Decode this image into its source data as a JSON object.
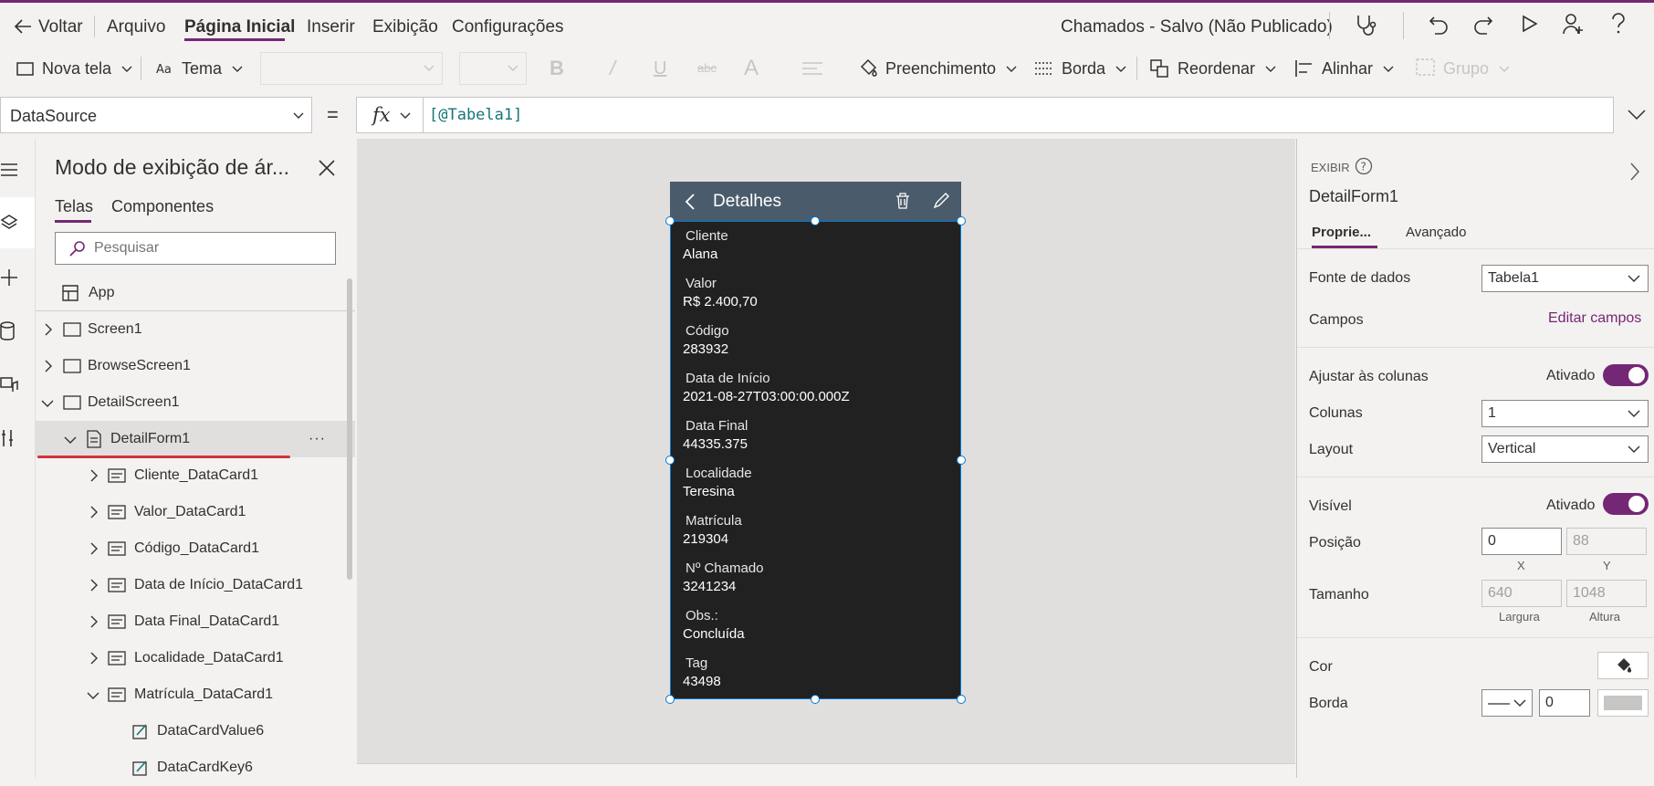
{
  "menubar": {
    "back": "Voltar",
    "items": [
      "Arquivo",
      "Página Inicial",
      "Inserir",
      "Exibição",
      "Configurações"
    ],
    "doc_title": "Chamados - Salvo (Não Publicado)"
  },
  "toolbar": {
    "new_screen": "Nova tela",
    "theme": "Tema",
    "fill": "Preenchimento",
    "border": "Borda",
    "reorder": "Reordenar",
    "align": "Alinhar",
    "group": "Grupo"
  },
  "formula": {
    "property": "DataSource",
    "equals": "=",
    "fx": "fx",
    "expression": "[@Tabela1]"
  },
  "tree": {
    "title": "Modo de exibição de ár...",
    "tabs": [
      "Telas",
      "Componentes"
    ],
    "search_placeholder": "Pesquisar",
    "items": [
      "App",
      "Screen1",
      "BrowseScreen1",
      "DetailScreen1",
      "DetailForm1",
      "Cliente_DataCard1",
      "Valor_DataCard1",
      "Código_DataCard1",
      "Data de Início_DataCard1",
      "Data Final_DataCard1",
      "Localidade_DataCard1",
      "Matrícula_DataCard1",
      "DataCardValue6",
      "DataCardKey6"
    ],
    "more": "···"
  },
  "screen": {
    "header_title": "Detalhes",
    "fields": [
      {
        "key": "Cliente",
        "value": "Alana"
      },
      {
        "key": "Valor",
        "value": "R$ 2.400,70"
      },
      {
        "key": "Código",
        "value": "283932"
      },
      {
        "key": "Data de Início",
        "value": "2021-08-27T03:00:00.000Z"
      },
      {
        "key": "Data Final",
        "value": "44335.375"
      },
      {
        "key": "Localidade",
        "value": "Teresina"
      },
      {
        "key": "Matrícula",
        "value": "219304"
      },
      {
        "key": "Nº Chamado",
        "value": "3241234"
      },
      {
        "key": "Obs.:",
        "value": "Concluída"
      },
      {
        "key": "Tag",
        "value": "43498"
      }
    ]
  },
  "properties": {
    "section": "EXIBIR",
    "control_name": "DetailForm1",
    "tabs": [
      "Proprie...",
      "Avançado"
    ],
    "datasource_label": "Fonte de dados",
    "datasource_value": "Tabela1",
    "fields_label": "Campos",
    "edit_fields": "Editar campos",
    "snap_label": "Ajustar às colunas",
    "snap_state": "Ativado",
    "columns_label": "Colunas",
    "columns_value": "1",
    "layout_label": "Layout",
    "layout_value": "Vertical",
    "visible_label": "Visível",
    "visible_state": "Ativado",
    "position_label": "Posição",
    "pos_x": "0",
    "pos_y": "88",
    "x_caption": "X",
    "y_caption": "Y",
    "size_label": "Tamanho",
    "width": "640",
    "height": "1048",
    "width_caption": "Largura",
    "height_caption": "Altura",
    "color_label": "Cor",
    "border_label": "Borda",
    "border_width": "0"
  },
  "colors": {
    "accent": "#742774",
    "form_bg": "#212121",
    "form_header": "#4a5b6b",
    "formula_text": "#16757a"
  }
}
